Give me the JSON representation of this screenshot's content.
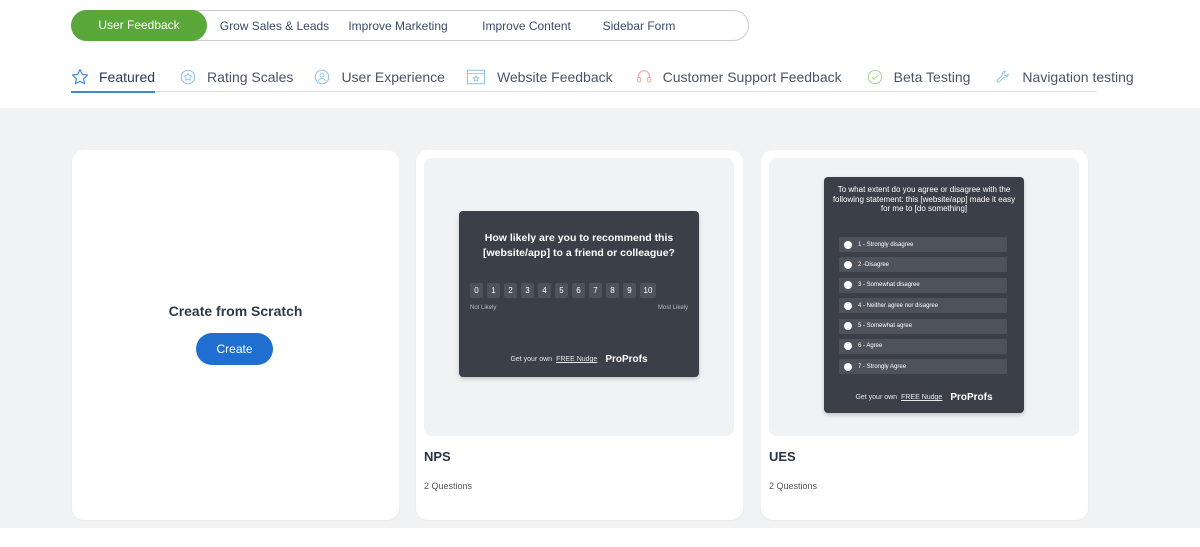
{
  "categories": [
    {
      "label": "User Feedback",
      "active": true
    },
    {
      "label": "Grow Sales & Leads"
    },
    {
      "label": "Improve Marketing"
    },
    {
      "label": "Improve Content"
    },
    {
      "label": "Sidebar Form"
    }
  ],
  "tabs": [
    {
      "label": "Featured",
      "icon": "star-icon",
      "active": true
    },
    {
      "label": "Rating Scales",
      "icon": "rating-scale-icon"
    },
    {
      "label": "User Experience",
      "icon": "user-experience-icon"
    },
    {
      "label": "Website Feedback",
      "icon": "website-feedback-icon"
    },
    {
      "label": "Customer Support Feedback",
      "icon": "headset-icon"
    },
    {
      "label": "Beta Testing",
      "icon": "check-circle-icon"
    },
    {
      "label": "Navigation testing",
      "icon": "wrench-icon"
    }
  ],
  "colors": {
    "accent_green": "#5aa73a",
    "primary_blue": "#1f6fd1",
    "tab_underline": "#3b8bd6",
    "preview_dark": "#3b3f47"
  },
  "scratch": {
    "title": "Create from Scratch",
    "button": "Create"
  },
  "nps": {
    "question": "How likely are you to recommend this [website/app] to a friend or colleague?",
    "scale": [
      "0",
      "1",
      "2",
      "3",
      "4",
      "5",
      "6",
      "7",
      "8",
      "9",
      "10"
    ],
    "low_label": "Not Likely",
    "high_label": "Most Likely",
    "footer_prefix": "Get your own",
    "footer_link": "FREE Nudge",
    "brand": "ProProfs",
    "name": "NPS",
    "count": "2 Questions"
  },
  "ues": {
    "question": "To what extent do you agree or disagree with the following statement: this [website/app] made it easy for me to [do something]",
    "options": [
      "1 - Strongly disagree",
      "2 -Disagree",
      "3 - Somewhat disagree",
      "4 - Neither agree nor disagree",
      "5 - Somewhat agree",
      "6 - Agree",
      "7 - Strongly Agree"
    ],
    "footer_prefix": "Get your own",
    "footer_link": "FREE Nudge",
    "brand": "ProProfs",
    "name": "UES",
    "count": "2 Questions"
  }
}
